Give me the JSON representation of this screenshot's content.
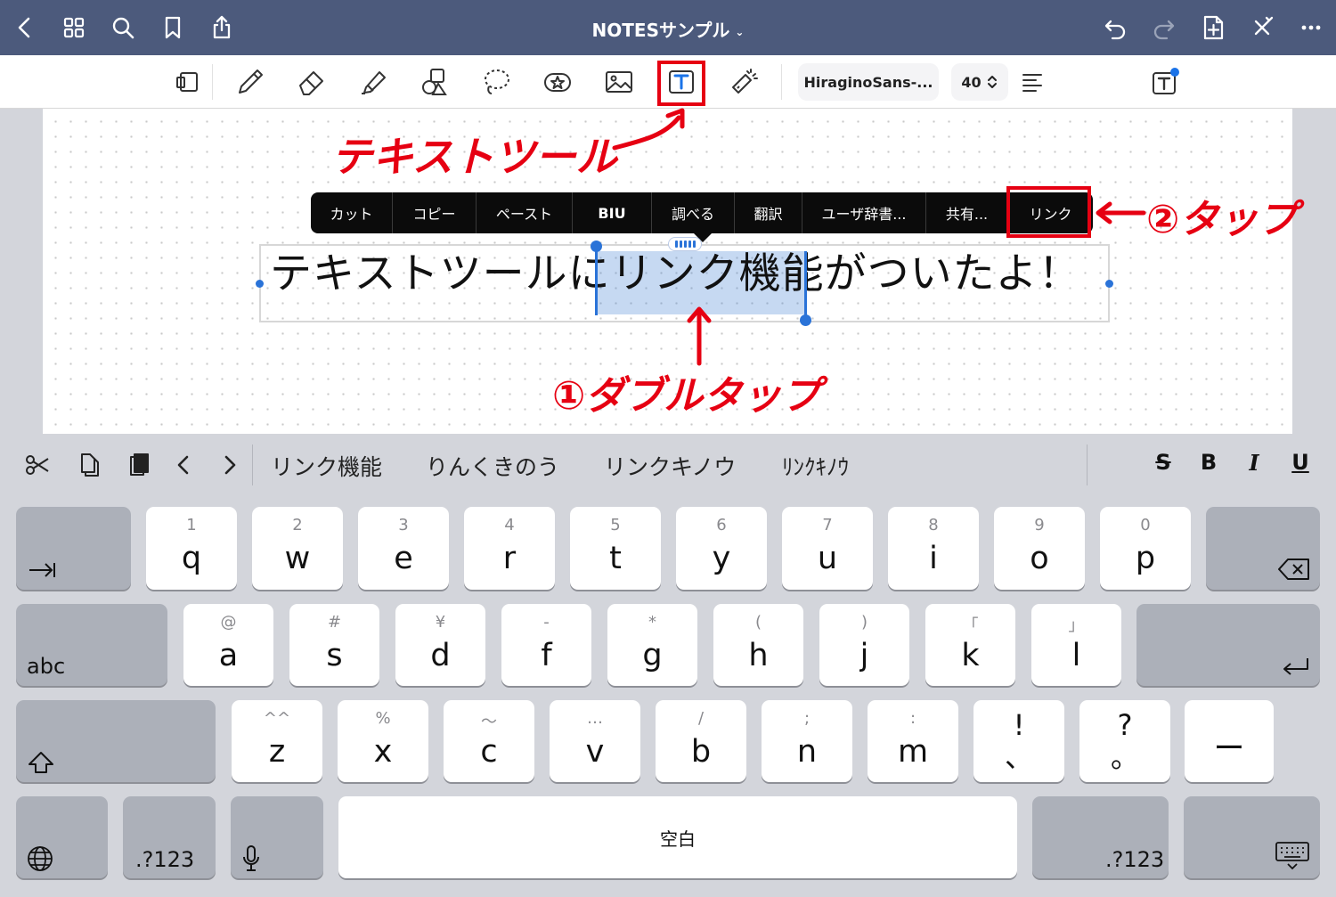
{
  "topbar": {
    "title": "NOTESサンプル",
    "title_chevron": "⌄",
    "icons": [
      "back-icon",
      "grid-icon",
      "search-icon",
      "bookmark-icon",
      "share-icon",
      "undo-icon",
      "redo-icon",
      "add-page-icon",
      "close-toolbar-icon",
      "more-icon"
    ]
  },
  "toolbar": {
    "tools": [
      "page-tool-icon",
      "pen-icon",
      "eraser-icon",
      "highlighter-icon",
      "shapes-icon",
      "lasso-icon",
      "sticker-icon",
      "image-icon",
      "text-tool-icon",
      "laser-pointer-icon"
    ],
    "font_name": "HiraginoSans-...",
    "font_size": "40",
    "font_size_chevron": "⌃⌄",
    "text_color": "#111111",
    "highlight_color": "#e60012"
  },
  "annotations": {
    "text_tool": "テキストツール",
    "double_tap": "①ダブルタップ",
    "tap": "②タップ"
  },
  "context_menu": {
    "items": [
      "カット",
      "コピー",
      "ペースト",
      "BIU",
      "調べる",
      "翻訳",
      "ユーザ辞書...",
      "共有...",
      "リンク"
    ]
  },
  "text_box": {
    "before": "テキストツールに",
    "selected": "リンク機能",
    "after": "がついたよ！"
  },
  "keyboard": {
    "suggestions": [
      "リンク機能",
      "りんくきのう",
      "リンクキノウ",
      "ﾘﾝｸｷﾉｳ"
    ],
    "format": [
      "S",
      "B",
      "I",
      "U"
    ],
    "row1": [
      [
        "1",
        "q"
      ],
      [
        "2",
        "w"
      ],
      [
        "3",
        "e"
      ],
      [
        "4",
        "r"
      ],
      [
        "5",
        "t"
      ],
      [
        "6",
        "y"
      ],
      [
        "7",
        "u"
      ],
      [
        "8",
        "i"
      ],
      [
        "9",
        "o"
      ],
      [
        "0",
        "p"
      ]
    ],
    "row2": [
      [
        "@",
        "a"
      ],
      [
        "#",
        "s"
      ],
      [
        "¥",
        "d"
      ],
      [
        "-",
        "f"
      ],
      [
        "*",
        "g"
      ],
      [
        "(",
        "h"
      ],
      [
        ")",
        "j"
      ],
      [
        "「",
        "k"
      ],
      [
        "」",
        "l"
      ]
    ],
    "row3": [
      [
        "^^",
        "z"
      ],
      [
        "%",
        "x"
      ],
      [
        "〜",
        "c"
      ],
      [
        "…",
        "v"
      ],
      [
        "/",
        "b"
      ],
      [
        ";",
        "n"
      ],
      [
        ":",
        "m"
      ],
      [
        "",
        "!\n、"
      ],
      [
        "",
        "?\n。"
      ]
    ],
    "abc": "abc",
    "dash": "ー",
    "space": "空白",
    "num_left": ".?123",
    "num_right": ".?123"
  }
}
